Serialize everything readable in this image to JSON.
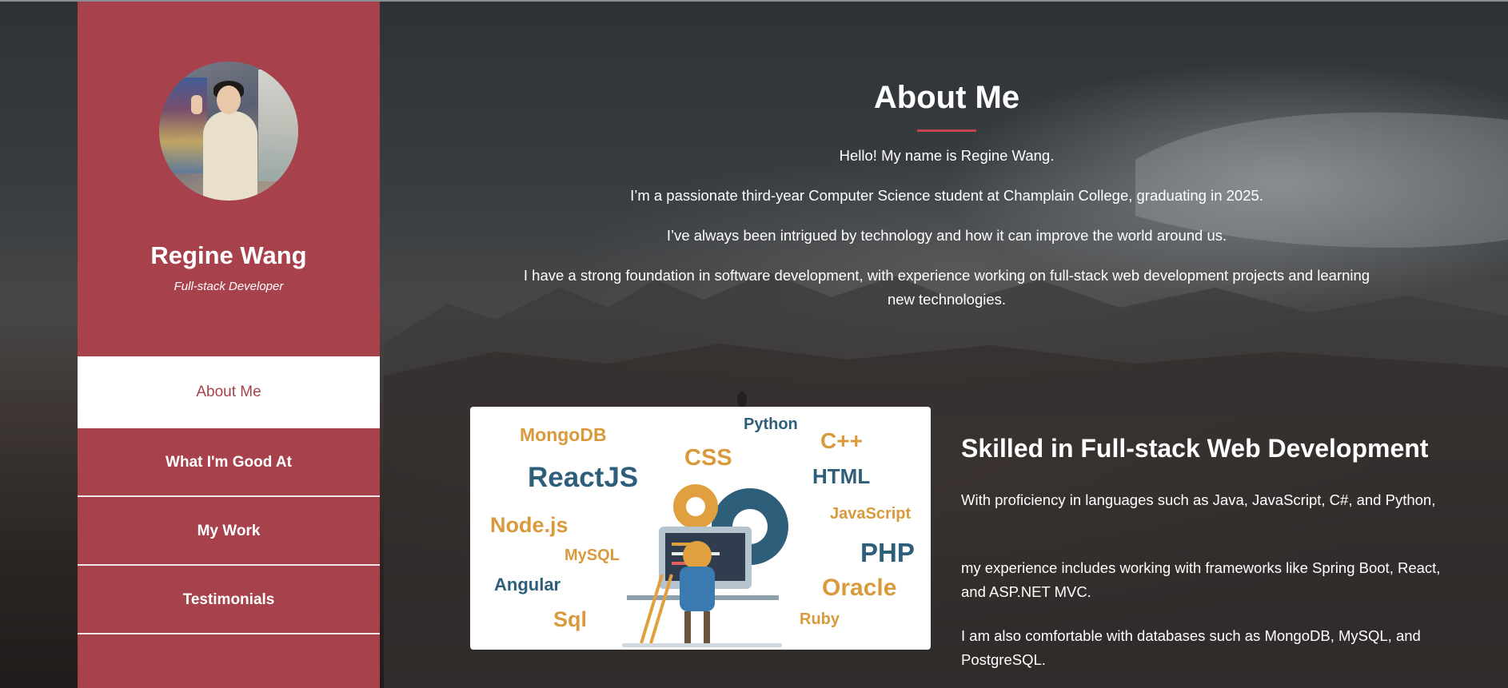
{
  "sidebar": {
    "name": "Regine Wang",
    "role": "Full-stack Developer",
    "nav": [
      {
        "label": "About Me",
        "active": true
      },
      {
        "label": "What I'm Good At",
        "active": false
      },
      {
        "label": "My Work",
        "active": false
      },
      {
        "label": "Testimonials",
        "active": false
      }
    ]
  },
  "about": {
    "title": "About Me",
    "paragraphs": [
      "Hello! My name is Regine Wang.",
      "I’m a passionate third-year Computer Science student at Champlain College, graduating in 2025.",
      "I’ve always been intrigued by technology and how it can improve the world around us.",
      "I have a strong foundation in software development, with experience working on full-stack web development projects and learning new technologies."
    ]
  },
  "skills": {
    "heading": "Skilled in Full-stack Web Development",
    "paragraphs": [
      "With proficiency in languages such as Java, JavaScript, C#, and Python,",
      "my experience includes working with frameworks like Spring Boot, React, and ASP.NET MVC.",
      "I am also comfortable with databases such as MongoDB, MySQL, and PostgreSQL."
    ],
    "image_words": {
      "mongodb": "MongoDB",
      "python": "Python",
      "cpp": "C++",
      "css": "CSS",
      "reactjs": "ReactJS",
      "html": "HTML",
      "nodejs": "Node.js",
      "javascript": "JavaScript",
      "mysql": "MySQL",
      "php": "PHP",
      "angular": "Angular",
      "oracle": "Oracle",
      "sql": "Sql",
      "ruby": "Ruby"
    }
  },
  "colors": {
    "sidebar": "#a7424d",
    "accent": "#c3434f",
    "orange": "#e0a040",
    "teal": "#2e5f7a"
  }
}
